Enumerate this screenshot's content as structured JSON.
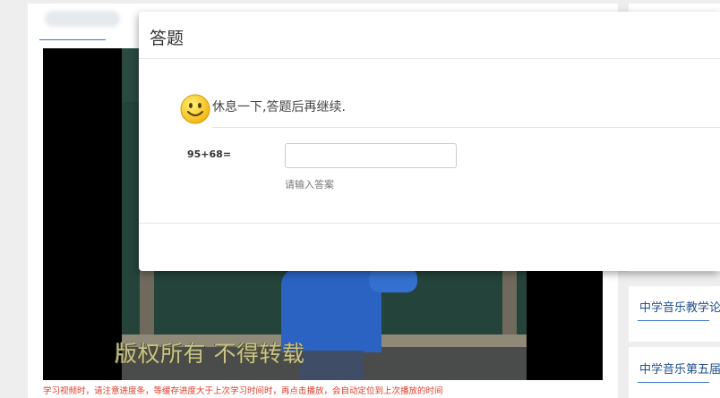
{
  "main": {
    "video": {
      "watermark": "版权所有 不得转载"
    },
    "notice": "学习视频时，请注意进度条，等缓存进度大于上次学习时间时，再点击播放，会自动定位到上次播放的时间"
  },
  "sidebar": {
    "items": [
      {
        "label": "中学音乐教学论"
      },
      {
        "label": "中学音乐第五届"
      }
    ]
  },
  "modal": {
    "title": "答题",
    "break_message": "休息一下,答题后再继续.",
    "question": "95+68=",
    "answer_value": "",
    "hint": "请输入答案",
    "smiley_icon": "smiley-face-icon"
  },
  "colors": {
    "accent": "#3a73c9",
    "notice": "#e23b2a",
    "smiley": "#f7c722"
  }
}
